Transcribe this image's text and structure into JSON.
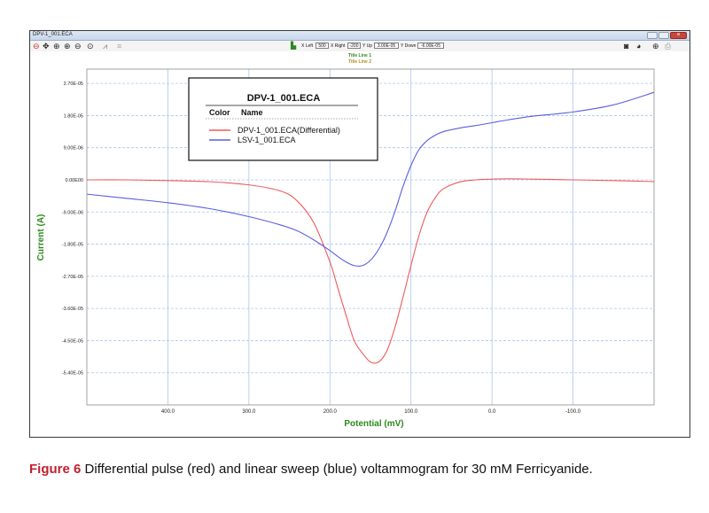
{
  "window": {
    "title": "DPV-1_001.ECA"
  },
  "toolbar": {
    "x_left_label": "X Left",
    "x_left_value": "500",
    "x_right_label": "X Right",
    "x_right_value": "-200",
    "y_up_label": "Y Up",
    "y_up_value": "3.00E-05",
    "y_down_label": "Y Down",
    "y_down_value": "-6.00E-05"
  },
  "title_lines": {
    "line1": "Title Line 1",
    "line2": "Title Line 2"
  },
  "caption": {
    "label": "Figure 6",
    "text": "Differential pulse (red) and linear sweep (blue) voltammogram for 30 mM Ferricyanide."
  },
  "chart_data": {
    "type": "line",
    "title": "",
    "xlabel": "Potential (mV)",
    "ylabel": "Current (A)",
    "xlim": [
      500,
      -200
    ],
    "ylim": [
      -6.3e-05,
      3.1e-05
    ],
    "x_reversed": true,
    "grid": true,
    "x_ticks": [
      {
        "value": 400,
        "label": "400.0"
      },
      {
        "value": 300,
        "label": "300.0"
      },
      {
        "value": 200,
        "label": "200.0"
      },
      {
        "value": 100,
        "label": "100.0"
      },
      {
        "value": 0,
        "label": "0.0"
      },
      {
        "value": -100,
        "label": "-100.0"
      }
    ],
    "y_ticks": [
      {
        "value": 2.7e-05,
        "label": "2.70E-05"
      },
      {
        "value": 1.8e-05,
        "label": "1.80E-05"
      },
      {
        "value": 9e-06,
        "label": "9.00E-06"
      },
      {
        "value": 0,
        "label": "0.00E00"
      },
      {
        "value": -9e-06,
        "label": "-9.00E-06"
      },
      {
        "value": -1.8e-05,
        "label": "-1.80E-05"
      },
      {
        "value": -2.7e-05,
        "label": "-2.70E-05"
      },
      {
        "value": -3.6e-05,
        "label": "-3.60E-05"
      },
      {
        "value": -4.5e-05,
        "label": "-4.50E-05"
      },
      {
        "value": -5.4e-05,
        "label": "-5.40E-05"
      }
    ],
    "legend": {
      "title": "DPV-1_001.ECA",
      "header_color": "Color",
      "header_name": "Name",
      "placement": "top-left"
    },
    "series": [
      {
        "name": "DPV-1_001.ECA(Differential)",
        "color": "#ee5a5a",
        "x": [
          500,
          450,
          400,
          350,
          300,
          260,
          240,
          220,
          200,
          190,
          180,
          170,
          160,
          150,
          140,
          130,
          120,
          110,
          100,
          90,
          80,
          70,
          60,
          40,
          20,
          0,
          -20,
          -50,
          -100,
          -150,
          -200
        ],
        "y": [
          0.0,
          0.0,
          -2e-07,
          -5e-07,
          -1.4e-06,
          -3.2e-06,
          -6e-06,
          -1.2e-05,
          -2.3e-05,
          -3.05e-05,
          -3.8e-05,
          -4.5e-05,
          -4.85e-05,
          -5.1e-05,
          -5.1e-05,
          -4.8e-05,
          -4.15e-05,
          -3.3e-05,
          -2.4e-05,
          -1.55e-05,
          -9e-06,
          -5e-06,
          -2.5e-06,
          -6e-07,
          0.0,
          2e-07,
          3e-07,
          2e-07,
          0.0,
          -2e-07,
          -5e-07
        ]
      },
      {
        "name": "LSV-1_001.ECA",
        "color": "#5a5fe0",
        "x": [
          500,
          450,
          400,
          350,
          300,
          260,
          240,
          220,
          200,
          190,
          180,
          170,
          160,
          150,
          140,
          130,
          120,
          110,
          100,
          90,
          80,
          70,
          60,
          40,
          20,
          0,
          -20,
          -50,
          -100,
          -150,
          -200
        ],
        "y": [
          -4e-06,
          -5.2e-06,
          -6.4e-06,
          -8e-06,
          -1.03e-05,
          -1.27e-05,
          -1.43e-05,
          -1.68e-05,
          -1.98e-05,
          -2.15e-05,
          -2.3e-05,
          -2.4e-05,
          -2.4e-05,
          -2.25e-05,
          -1.95e-05,
          -1.5e-05,
          -9e-06,
          -2e-06,
          4e-06,
          8.5e-06,
          1.1e-05,
          1.25e-05,
          1.35e-05,
          1.45e-05,
          1.52e-05,
          1.6e-05,
          1.68e-05,
          1.78e-05,
          1.9e-05,
          2.1e-05,
          2.45e-05
        ]
      }
    ]
  }
}
